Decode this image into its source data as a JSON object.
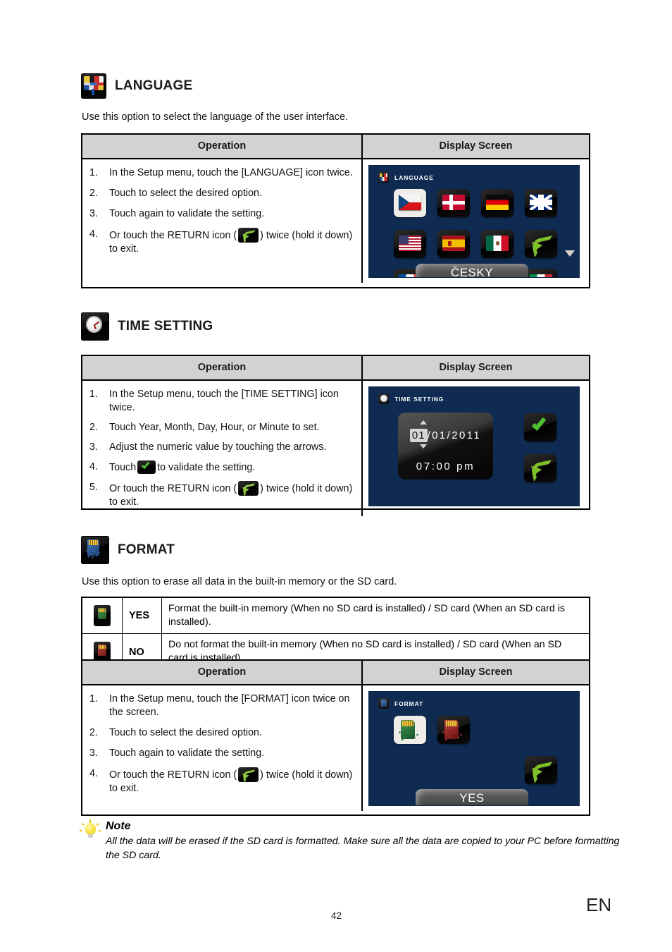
{
  "page": {
    "number": "42",
    "language_code": "EN"
  },
  "sections": [
    {
      "id": "language",
      "icon": "language-flags-icon",
      "title": "LANGUAGE",
      "intro": "Use this option to select the language of the user interface.",
      "table": {
        "headers": {
          "operation": "Operation",
          "display": "Display Screen"
        },
        "steps": [
          {
            "num": "1.",
            "before": "In the Setup menu, touch the [LANGUAGE] icon twice.",
            "icon": null,
            "after": ""
          },
          {
            "num": "2.",
            "before": "Touch to select the desired option.",
            "icon": null,
            "after": ""
          },
          {
            "num": "3.",
            "before": "Touch again to validate the setting.",
            "icon": null,
            "after": ""
          },
          {
            "num": "4.",
            "before": "Or touch the RETURN icon (",
            "icon": "return-icon",
            "after": ") twice (hold it down) to exit."
          }
        ]
      },
      "screen": {
        "title": "LANGUAGE",
        "title_icon": "language-flags-icon",
        "selected_label": "ČESKY",
        "scroll_indicator": "scroll-down-triangle",
        "tiles": [
          {
            "name": "flag-czech",
            "flag": "f-cz",
            "selected": true
          },
          {
            "name": "flag-denmark",
            "flag": "f-dk",
            "selected": false
          },
          {
            "name": "flag-germany",
            "flag": "f-de",
            "selected": false
          },
          {
            "name": "flag-united-kingdom",
            "flag": "f-uk",
            "selected": false
          },
          {
            "name": "flag-united-states",
            "flag": "f-us",
            "selected": false
          },
          {
            "name": "flag-spain",
            "flag": "f-es",
            "selected": false
          },
          {
            "name": "flag-mexico",
            "flag": "f-mx",
            "selected": false
          },
          {
            "name": "return-button",
            "flag": "return",
            "selected": false
          },
          {
            "name": "flag-france",
            "flag": "f-fr",
            "selected": false
          },
          {
            "name": "flag-italy",
            "flag": "f-it",
            "selected": false
          }
        ]
      }
    },
    {
      "id": "time-setting",
      "icon": "clock-icon",
      "title": "TIME SETTING",
      "intro": null,
      "table": {
        "headers": {
          "operation": "Operation",
          "display": "Display Screen"
        },
        "steps": [
          {
            "num": "1.",
            "before": "In the Setup menu, touch the [TIME SETTING] icon twice.",
            "icon": null,
            "after": ""
          },
          {
            "num": "2.",
            "before": "Touch Year, Month, Day, Hour, or Minute to set.",
            "icon": null,
            "after": ""
          },
          {
            "num": "3.",
            "before": "Adjust the numeric value by touching the arrows.",
            "icon": null,
            "after": ""
          },
          {
            "num": "4.",
            "before": "Touch",
            "icon": "check-icon",
            "after": "to validate the setting."
          },
          {
            "num": "5.",
            "before": "Or touch the RETURN icon (",
            "icon": "return-icon",
            "after": ") twice (hold it down) to exit."
          }
        ]
      },
      "screen": {
        "title": "TIME SETTING",
        "title_icon": "clock-icon",
        "date": {
          "day": "01",
          "month": "01",
          "year": "2011",
          "sep": "/"
        },
        "time": {
          "hour": "07",
          "minute": "00",
          "meridiem": "pm",
          "sep": ":"
        },
        "buttons": [
          {
            "name": "validate-button",
            "icon": "check-icon"
          },
          {
            "name": "return-button",
            "icon": "return-icon"
          }
        ]
      }
    },
    {
      "id": "format",
      "icon": "format-sd-card-icon",
      "title": "FORMAT",
      "intro": "Use this option to erase all data in the built-in memory or the SD card.",
      "options": [
        {
          "icon": "sd-card-green-icon",
          "label": "YES",
          "description": "Format the built-in memory (When no SD card is installed) / SD card (When an SD card is installed)."
        },
        {
          "icon": "sd-card-red-icon",
          "label": "NO",
          "description": "Do not format the built-in memory (When no SD card is installed) / SD card (When an SD card is installed)."
        }
      ],
      "table": {
        "headers": {
          "operation": "Operation",
          "display": "Display Screen"
        },
        "steps": [
          {
            "num": "1.",
            "before": "In the Setup menu, touch the [FORMAT] icon twice on the screen.",
            "icon": null,
            "after": ""
          },
          {
            "num": "2.",
            "before": "Touch to select the desired option.",
            "icon": null,
            "after": ""
          },
          {
            "num": "3.",
            "before": "Touch again to validate the setting.",
            "icon": null,
            "after": ""
          },
          {
            "num": "4.",
            "before": "Or touch the RETURN icon (",
            "icon": "return-icon",
            "after": ") twice (hold it down) to exit."
          }
        ]
      },
      "screen": {
        "title": "FORMAT",
        "title_icon": "format-sd-card-icon",
        "selected_label": "YES",
        "tiles": [
          {
            "name": "format-yes-tile",
            "kind": "green",
            "selected": true
          },
          {
            "name": "format-no-tile",
            "kind": "red",
            "selected": false
          },
          {
            "name": "return-button",
            "kind": "return",
            "selected": false
          }
        ]
      }
    }
  ],
  "note": {
    "icon": "lightbulb-icon",
    "title": "Note",
    "text": "All the data will be erased if the SD card is formatted. Make sure all the data are copied to your PC before formatting the SD card."
  },
  "colors": {
    "screen_bg": "#0f2b52",
    "table_header_bg": "#d2d2d2",
    "accent_green": "#7fbf2a",
    "selected_tile_bg": "#f0ece8"
  }
}
